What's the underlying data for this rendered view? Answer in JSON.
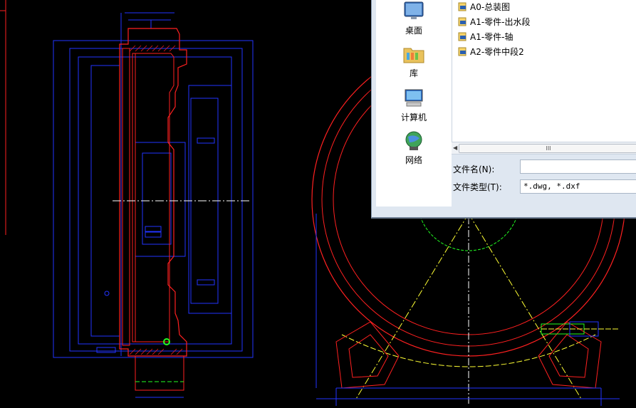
{
  "dialog": {
    "places": [
      {
        "label": "桌面",
        "icon": "desktop-icon"
      },
      {
        "label": "库",
        "icon": "library-folder-icon"
      },
      {
        "label": "计算机",
        "icon": "computer-icon"
      },
      {
        "label": "网络",
        "icon": "network-globe-icon"
      }
    ],
    "files": [
      {
        "name": "A0-总装图",
        "icon": "dwg-file-icon"
      },
      {
        "name": "A1-零件-出水段",
        "icon": "dwg-file-icon"
      },
      {
        "name": "A1-零件-轴",
        "icon": "dwg-file-icon"
      },
      {
        "name": "A2-零件中段2",
        "icon": "dwg-file-icon"
      }
    ],
    "scroll_grip": "III",
    "filename_label": "文件名(N):",
    "filename_value": "",
    "filetype_label": "文件类型(T):",
    "filetype_value": "*.dwg, *.dxf"
  },
  "colors": {
    "cad_red": "#ff2020",
    "cad_blue": "#2233ff",
    "cad_yellow": "#ffff33",
    "cad_green": "#22ff22",
    "cad_white": "#ffffff"
  }
}
